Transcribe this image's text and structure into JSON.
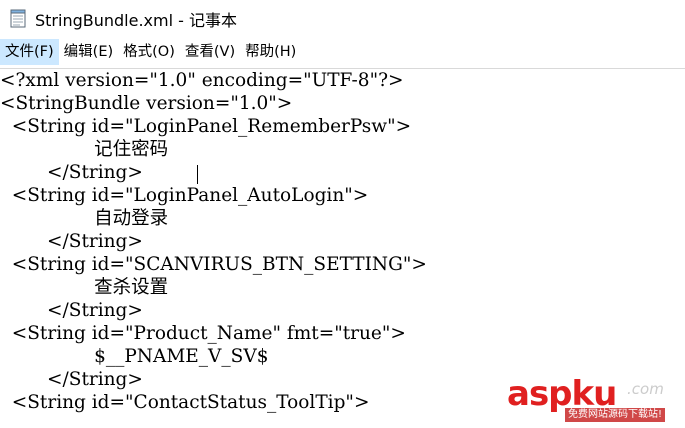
{
  "window": {
    "title": "StringBundle.xml - 记事本",
    "icon": "notepad-icon"
  },
  "menu": [
    {
      "label": "文件(F)"
    },
    {
      "label": "编辑(E)"
    },
    {
      "label": "格式(O)"
    },
    {
      "label": "查看(V)"
    },
    {
      "label": "帮助(H)"
    }
  ],
  "editor": {
    "lines": [
      "<?xml version=\"1.0\" encoding=\"UTF-8\"?>",
      "<StringBundle version=\"1.0\">",
      "  <String id=\"LoginPanel_RememberPsw\">",
      "                记住密码",
      "        </String>",
      "  <String id=\"LoginPanel_AutoLogin\">",
      "                自动登录",
      "        </String>",
      "  <String id=\"SCANVIRUS_BTN_SETTING\">",
      "                查杀设置",
      "        </String>",
      "  <String id=\"Product_Name\" fmt=\"true\">",
      "                $__PNAME_V_SV$",
      "        </String>",
      "  <String id=\"ContactStatus_ToolTip\">"
    ]
  },
  "watermark": {
    "logo_part1": "asp",
    "logo_part2": "ku",
    "logo_suffix": ".com",
    "subtitle": "免费网站源码下载站!"
  }
}
